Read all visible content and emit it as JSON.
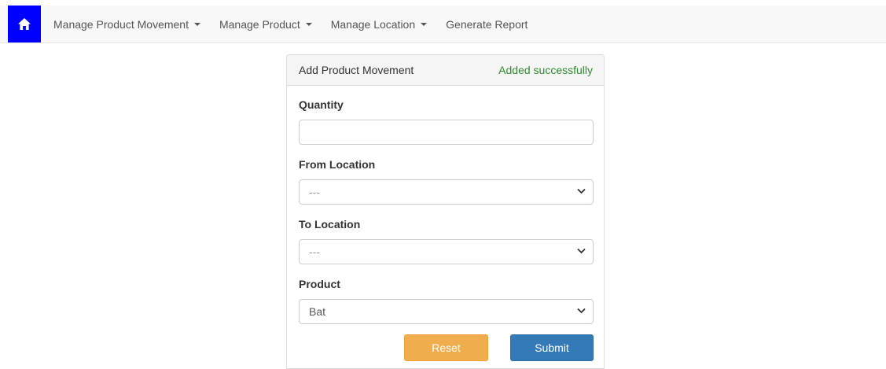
{
  "nav": {
    "home_icon": "home-icon",
    "items": [
      {
        "label": "Manage Product Movement",
        "has_dropdown": true
      },
      {
        "label": "Manage Product",
        "has_dropdown": true
      },
      {
        "label": "Manage Location",
        "has_dropdown": true
      },
      {
        "label": "Generate Report",
        "has_dropdown": false
      }
    ]
  },
  "panel": {
    "title": "Add Product Movement",
    "status": "Added successfully",
    "status_color": "#2e8b2e"
  },
  "form": {
    "quantity": {
      "label": "Quantity",
      "value": ""
    },
    "from_location": {
      "label": "From Location",
      "selected": "---"
    },
    "to_location": {
      "label": "To Location",
      "selected": "---"
    },
    "product": {
      "label": "Product",
      "selected": "Bat"
    },
    "reset_label": "Reset",
    "submit_label": "Submit"
  },
  "colors": {
    "home_bg": "#0000ff",
    "reset_bg": "#f0ad4e",
    "submit_bg": "#337ab7"
  }
}
